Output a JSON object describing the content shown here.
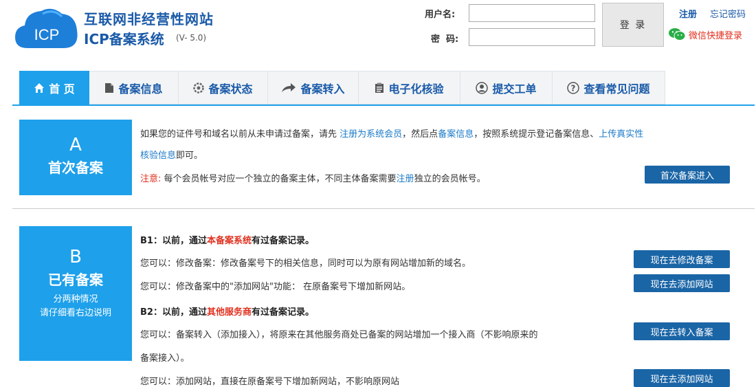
{
  "header": {
    "logo_text": "ICP",
    "title": "互联网非经营性网站",
    "subtitle": "ICP备案系统",
    "version": "(V- 5.0)",
    "username_label": "用户名:",
    "password_label": "密  码:",
    "username_value": "",
    "password_value": "",
    "login_button": "登 录",
    "register_link": "注册",
    "forgot_link": "忘记密码",
    "wechat_login": "微信快捷登录"
  },
  "nav": {
    "items": [
      {
        "label": "首 页",
        "icon": "home-icon"
      },
      {
        "label": "备案信息",
        "icon": "document-icon"
      },
      {
        "label": "备案状态",
        "icon": "gear-icon"
      },
      {
        "label": "备案转入",
        "icon": "arrow-icon"
      },
      {
        "label": "电子化核验",
        "icon": "clipboard-icon"
      },
      {
        "label": "提交工单",
        "icon": "user-icon"
      },
      {
        "label": "查看常见问题",
        "icon": "question-icon"
      }
    ]
  },
  "section_a": {
    "letter": "A",
    "name": "首次备案",
    "line1_prefix": "如果您的证件号和域名以前从未申请过备案，请先",
    "line1_link1": "注册为系统会员",
    "line1_mid": "，然后点",
    "line1_link2": "备案信息",
    "line1_mid2": "，按照系统提示登记备案信息、",
    "line1_link3": "上传真实性",
    "line2_link": "核验信息",
    "line2_suffix": "即可。",
    "note_label": "注意:",
    "note_prefix": "每个会员帐号对应一个独立的备案主体，不同主体备案需要",
    "note_link": "注册",
    "note_suffix": "独立的会员帐号。",
    "button": "首次备案进入"
  },
  "section_b": {
    "letter": "B",
    "name": "已有备案",
    "sub1": "分两种情况",
    "sub2": "请仔细看右边说明",
    "b1_prefix": "B1：以前，通过",
    "b1_highlight": "本备案系统",
    "b1_suffix": "有过备案记录。",
    "b1_line1": "您可以：修改备案：修改备案号下的相关信息，同时可以为原有网站增加新的域名。",
    "b1_line2": "您可以：修改备案中的\"添加网站\"功能：  在原备案号下增加新网站。",
    "b2_prefix": "B2：以前，通过",
    "b2_highlight": "其他服务商",
    "b2_suffix": "有过备案记录。",
    "b2_line1": "您可以：备案转入（添加接入），将原来在其他服务商处已备案的网站增加一个接入商（不影响原来的",
    "b2_line1_cont": "备案接入）。",
    "b2_line2": "您可以：添加网站，直接在原备案号下增加新网站，不影响原网站",
    "btn_modify": "现在去修改备案",
    "btn_add_site": "现在去添加网站",
    "btn_transfer": "现在去转入备案",
    "btn_add_site2": "现在去添加网站"
  },
  "colors": {
    "accent": "#1ea0ea",
    "brand": "#1a5aa8",
    "button": "#1a65a6",
    "alert": "#e0301e"
  }
}
